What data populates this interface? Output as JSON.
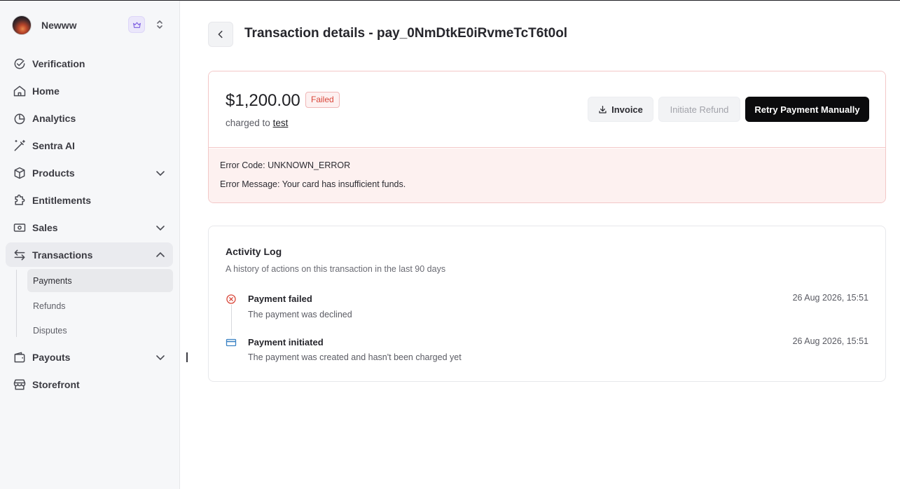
{
  "workspace": {
    "name": "Newww"
  },
  "sidebar": {
    "items": [
      {
        "label": "Verification"
      },
      {
        "label": "Home"
      },
      {
        "label": "Analytics"
      },
      {
        "label": "Sentra AI"
      },
      {
        "label": "Products"
      },
      {
        "label": "Entitlements"
      },
      {
        "label": "Sales"
      },
      {
        "label": "Transactions"
      },
      {
        "label": "Payouts"
      },
      {
        "label": "Storefront"
      }
    ],
    "transactions_sub": [
      {
        "label": "Payments"
      },
      {
        "label": "Refunds"
      },
      {
        "label": "Disputes"
      }
    ]
  },
  "header": {
    "title": "Transaction details - pay_0NmDtkE0iRvmeTcT6t0ol"
  },
  "summary": {
    "amount": "$1,200.00",
    "status": "Failed",
    "charged_prefix": "charged to",
    "charged_to": "test",
    "buttons": {
      "invoice": "Invoice",
      "refund": "Initiate Refund",
      "retry": "Retry Payment Manually"
    },
    "error_code": "Error Code: UNKNOWN_ERROR",
    "error_message": "Error Message: Your card has insufficient funds."
  },
  "activity": {
    "title": "Activity Log",
    "subtitle": "A history of actions on this transaction in the last 90 days",
    "events": [
      {
        "title": "Payment failed",
        "desc": "The payment was declined",
        "time": "26 Aug 2026, 15:51",
        "icon": "x-circle-icon"
      },
      {
        "title": "Payment initiated",
        "desc": "The payment was created and hasn't been charged yet",
        "time": "26 Aug 2026, 15:51",
        "icon": "card-icon"
      }
    ]
  },
  "colors": {
    "accent": "#0b0b0d",
    "error": "#d9473a",
    "error_bg": "#fdf1f0",
    "card_blue": "#3b82c4"
  }
}
